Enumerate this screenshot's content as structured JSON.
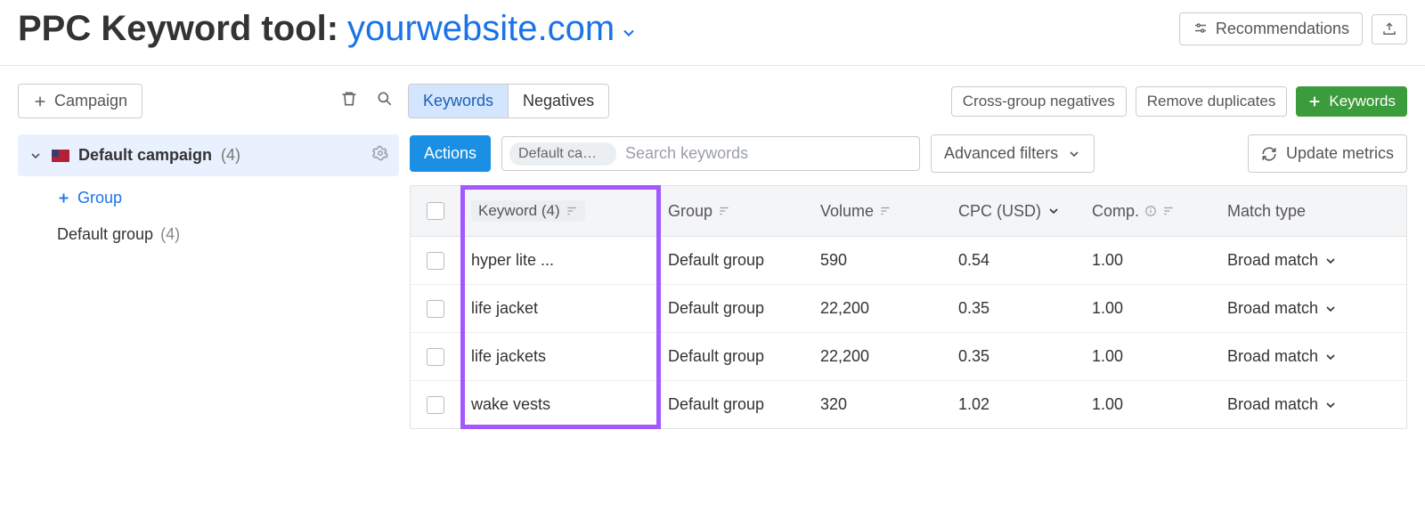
{
  "header": {
    "title_prefix": "PPC Keyword tool:",
    "domain": "yourwebsite.com",
    "recommendations_label": "Recommendations"
  },
  "toolbar": {
    "campaign_button": "Campaign",
    "tabs": {
      "keywords": "Keywords",
      "negatives": "Negatives"
    },
    "cross_group": "Cross-group negatives",
    "remove_dupes": "Remove duplicates",
    "add_keywords": "Keywords"
  },
  "sidebar": {
    "default_campaign_label": "Default campaign",
    "default_campaign_count": "(4)",
    "add_group": "Group",
    "default_group_label": "Default group",
    "default_group_count": "(4)"
  },
  "actionbar": {
    "actions": "Actions",
    "chip": "Default campa",
    "search_placeholder": "Search keywords",
    "advanced_filters": "Advanced filters",
    "update_metrics": "Update metrics"
  },
  "table": {
    "headers": {
      "keyword": "Keyword (4)",
      "group": "Group",
      "volume": "Volume",
      "cpc": "CPC (USD)",
      "comp": "Comp.",
      "match": "Match type"
    },
    "rows": [
      {
        "keyword": "hyper lite ...",
        "group": "Default group",
        "volume": "590",
        "cpc": "0.54",
        "comp": "1.00",
        "match": "Broad match"
      },
      {
        "keyword": "life jacket",
        "group": "Default group",
        "volume": "22,200",
        "cpc": "0.35",
        "comp": "1.00",
        "match": "Broad match"
      },
      {
        "keyword": "life jackets",
        "group": "Default group",
        "volume": "22,200",
        "cpc": "0.35",
        "comp": "1.00",
        "match": "Broad match"
      },
      {
        "keyword": "wake vests",
        "group": "Default group",
        "volume": "320",
        "cpc": "1.02",
        "comp": "1.00",
        "match": "Broad match"
      }
    ]
  }
}
